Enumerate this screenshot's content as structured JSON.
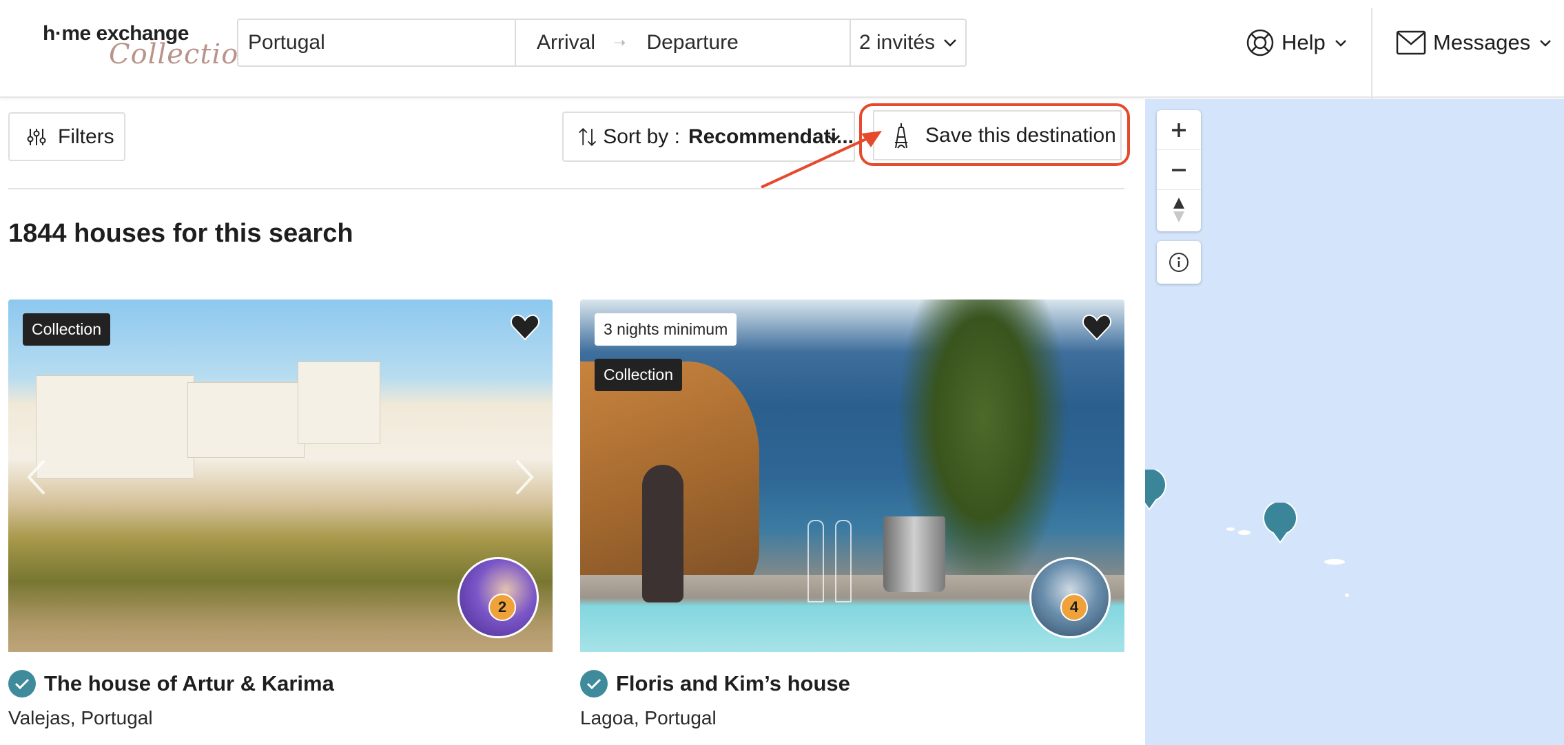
{
  "header": {
    "logo": {
      "line1": "h·me exchange",
      "line2": "Collection"
    },
    "search": {
      "destination": "Portugal",
      "arrival": "Arrival",
      "departure": "Departure",
      "guests": "2 invités"
    },
    "help_label": "Help",
    "messages_label": "Messages"
  },
  "toolbar": {
    "filters_label": "Filters",
    "sort_prefix": "Sort by :",
    "sort_value": "Recommendati...",
    "save_destination_label": "Save this destination"
  },
  "results": {
    "count_text": "1844 houses for this search",
    "cards": [
      {
        "tags": [
          "Collection"
        ],
        "title": "The house of Artur & Karima",
        "location": "Valejas, Portugal",
        "badge": "2"
      },
      {
        "tags": [
          "3 nights minimum",
          "Collection"
        ],
        "title": "Floris and Kim’s house",
        "location": "Lagoa, Portugal",
        "badge": "4"
      }
    ]
  },
  "colors": {
    "accent_teal": "#3f8b9b",
    "annotation_red": "#e64a2d",
    "map_water": "#d4e5fb",
    "badge_orange": "#f0a23a"
  },
  "icons": [
    "filters-icon",
    "sort-icon",
    "eiffel-tower-icon",
    "help-lifebuoy-icon",
    "envelope-icon",
    "heart-icon",
    "verified-check-icon",
    "zoom-in-icon",
    "zoom-out-icon",
    "compass-icon",
    "info-icon",
    "map-pin-icon"
  ]
}
